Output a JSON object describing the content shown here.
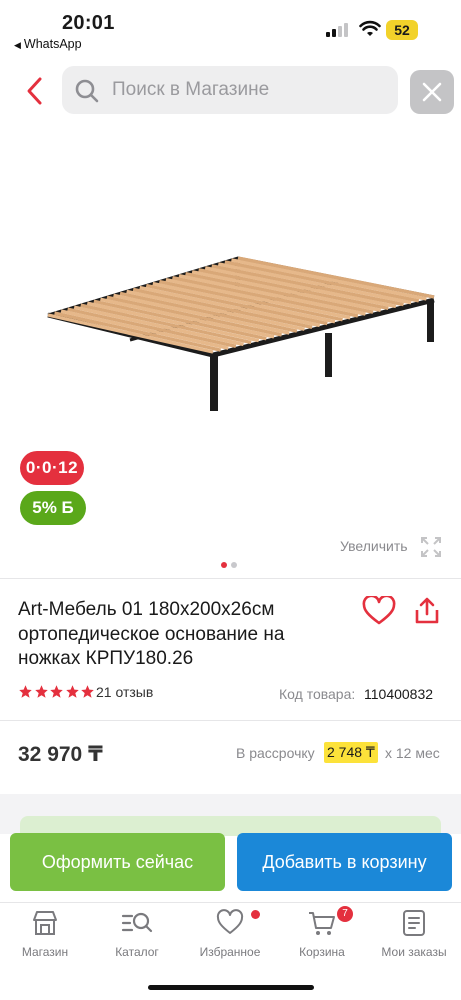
{
  "status_bar": {
    "time": "20:01",
    "back_app": "WhatsApp",
    "battery": "52"
  },
  "search": {
    "placeholder": "Поиск в Магазине"
  },
  "product_image": {
    "badge_installment": "0·0·12",
    "badge_bonus": "5% Б",
    "zoom_label": "Увеличить",
    "slide_count": 2,
    "active_slide": 1
  },
  "product": {
    "title": "Art-Мебель 01 180х200х26см ортопедическое основание на ножках КРПУ180.26",
    "rating_stars": 5,
    "reviews": "21 отзыв",
    "sku_label": "Код товара:",
    "sku": "110400832",
    "price": "32 970 ₸",
    "installment_label": "В рассрочку",
    "installment_amount": "2 748 ₸",
    "installment_term": "х 12 мес"
  },
  "actions": {
    "buy_now": "Оформить сейчас",
    "add_to_cart": "Добавить в корзину"
  },
  "tabbar": {
    "items": [
      {
        "label": "Магазин",
        "icon": "shop-icon"
      },
      {
        "label": "Каталог",
        "icon": "catalog-search-icon"
      },
      {
        "label": "Избранное",
        "icon": "heart-icon"
      },
      {
        "label": "Корзина",
        "icon": "cart-icon"
      },
      {
        "label": "Мои заказы",
        "icon": "orders-icon"
      }
    ],
    "cart_count": "7"
  },
  "colors": {
    "accent_red": "#e4303e",
    "bonus_green": "#5aa81a",
    "buy_green": "#7ac043",
    "cart_blue": "#1b88d8",
    "installment_yellow": "#fce23a"
  }
}
